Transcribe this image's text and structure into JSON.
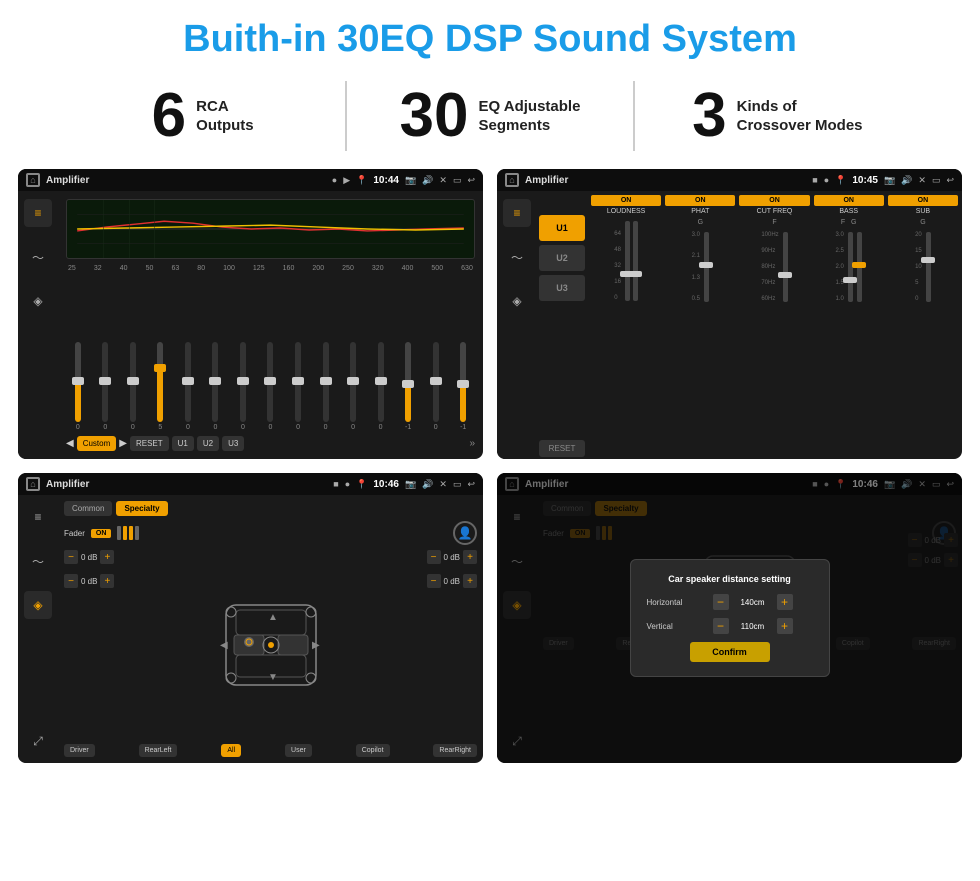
{
  "page": {
    "title": "Buith-in 30EQ DSP Sound System",
    "stats": [
      {
        "number": "6",
        "desc": "RCA\nOutputs"
      },
      {
        "number": "30",
        "desc": "EQ Adjustable\nSegments"
      },
      {
        "number": "3",
        "desc": "Kinds of\nCrossover Modes"
      }
    ]
  },
  "screens": {
    "s1": {
      "title": "Amplifier",
      "time": "10:44",
      "eq_freqs": [
        "25",
        "32",
        "40",
        "50",
        "63",
        "80",
        "100",
        "125",
        "160",
        "200",
        "250",
        "320",
        "400",
        "500",
        "630"
      ],
      "eq_values": [
        "0",
        "0",
        "0",
        "5",
        "0",
        "0",
        "0",
        "0",
        "0",
        "0",
        "0",
        "0",
        "-1",
        "0",
        "-1"
      ],
      "eq_modes": [
        "Custom",
        "RESET",
        "U1",
        "U2",
        "U3"
      ]
    },
    "s2": {
      "title": "Amplifier",
      "time": "10:45",
      "channels": [
        "U1",
        "U2",
        "U3"
      ],
      "params": [
        "LOUDNESS",
        "PHAT",
        "CUT FREQ",
        "BASS",
        "SUB"
      ]
    },
    "s3": {
      "title": "Amplifier",
      "time": "10:46",
      "tabs": [
        "Common",
        "Specialty"
      ],
      "fader_label": "Fader",
      "fader_on": "ON",
      "bottom_btns": [
        "Driver",
        "RearLeft",
        "All",
        "User",
        "Copilot",
        "RearRight"
      ]
    },
    "s4": {
      "title": "Amplifier",
      "time": "10:46",
      "tabs": [
        "Common",
        "Specialty"
      ],
      "dialog": {
        "title": "Car speaker distance setting",
        "horizontal_label": "Horizontal",
        "horizontal_value": "140cm",
        "vertical_label": "Vertical",
        "vertical_value": "110cm",
        "confirm_label": "Confirm"
      }
    }
  }
}
